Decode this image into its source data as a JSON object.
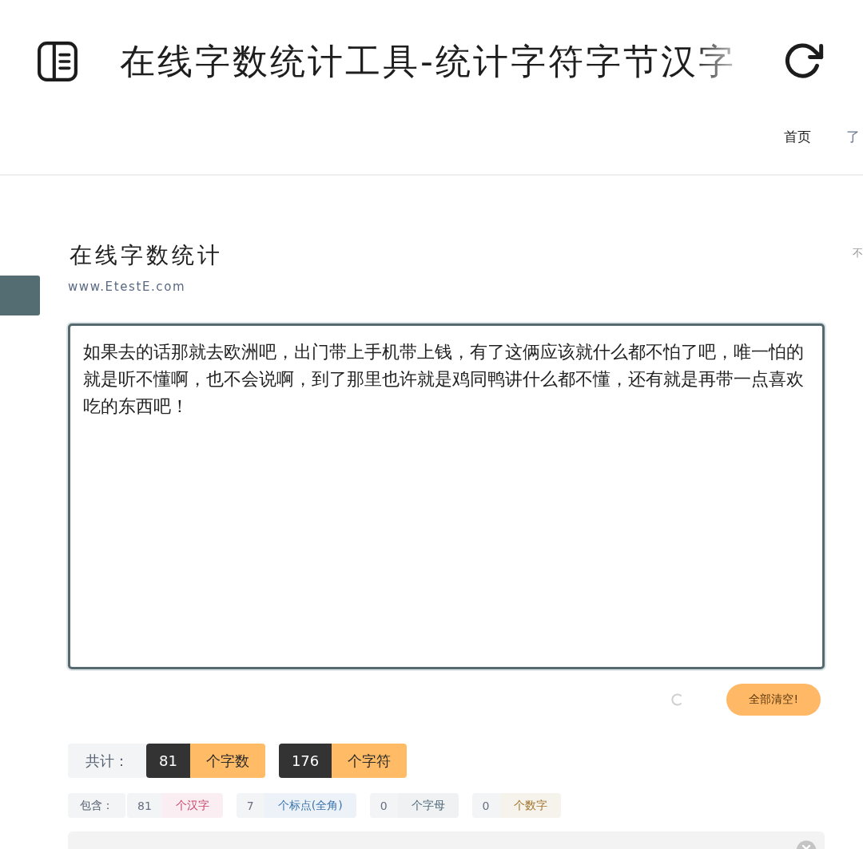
{
  "header": {
    "title": "在线字数统计工具-统计字符字节汉字",
    "nav": [
      {
        "label": "首页",
        "selected": true
      },
      {
        "label": "了",
        "selected": false
      }
    ]
  },
  "page": {
    "heading": "在线字数统计",
    "site": "www.EtestE.com",
    "side_note": "不"
  },
  "editor": {
    "value": "如果去的话那就去欧洲吧，出门带上手机带上钱，有了这俩应该就什么都不怕了吧，唯一怕的就是听不懂啊，也不会说啊，到了那里也许就是鸡同鸭讲什么都不懂，还有就是再带一点喜欢吃的东西吧！",
    "loading": true,
    "clear_button": "全部清空!"
  },
  "totals": {
    "label": "共计：",
    "items": [
      {
        "count": "81",
        "unit": "个字数"
      },
      {
        "count": "176",
        "unit": "个字符"
      }
    ]
  },
  "breakdown": {
    "label": "包含：",
    "items": [
      {
        "count": "81",
        "unit": "个汉字",
        "color": "#c8466e"
      },
      {
        "count": "7",
        "unit": "个标点(全角)",
        "color": "#3a74ad"
      },
      {
        "count": "0",
        "unit": "个字母",
        "color": "#4d6878"
      },
      {
        "count": "0",
        "unit": "个数字",
        "color": "#a0742a"
      }
    ]
  }
}
